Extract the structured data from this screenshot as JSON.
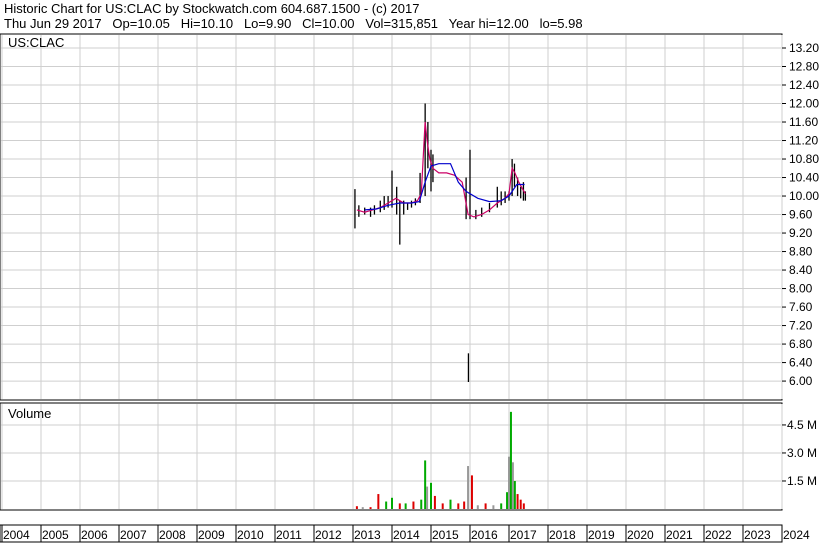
{
  "header": {
    "line1": "Historic Chart for US:CLAC by Stockwatch.com 604.687.1500 - (c) 2017",
    "line2": "Thu Jun 29 2017   Op=10.05   Hi=10.10   Lo=9.90   Cl=10.00   Vol=315,851   Year hi=12.00   lo=5.98"
  },
  "chart_data": [
    {
      "type": "line",
      "title": "US:CLAC",
      "ylim": [
        5.8,
        13.4
      ],
      "yticks": [
        "13.20",
        "12.80",
        "12.40",
        "12.00",
        "11.60",
        "11.20",
        "10.80",
        "10.40",
        "10.00",
        "9.60",
        "9.20",
        "8.80",
        "8.40",
        "8.00",
        "7.60",
        "7.20",
        "6.80",
        "6.40",
        "6.00"
      ],
      "xlim": [
        2004,
        2024
      ],
      "xticks": [
        "2004",
        "2005",
        "2006",
        "2007",
        "2008",
        "2009",
        "2010",
        "2011",
        "2012",
        "2013",
        "2014",
        "2015",
        "2016",
        "2017",
        "2018",
        "2019",
        "2020",
        "2021",
        "2022",
        "2023",
        "2024"
      ],
      "grid": true,
      "series": [
        {
          "style": "price-bars",
          "color": "#000000",
          "points": [
            {
              "x": 2013.05,
              "hi": 10.15,
              "lo": 9.3
            },
            {
              "x": 2013.15,
              "hi": 9.8,
              "lo": 9.55
            },
            {
              "x": 2013.3,
              "hi": 9.75,
              "lo": 9.6
            },
            {
              "x": 2013.45,
              "hi": 9.75,
              "lo": 9.55
            },
            {
              "x": 2013.55,
              "hi": 9.8,
              "lo": 9.6
            },
            {
              "x": 2013.7,
              "hi": 9.9,
              "lo": 9.65
            },
            {
              "x": 2013.8,
              "hi": 10.0,
              "lo": 9.7
            },
            {
              "x": 2013.9,
              "hi": 10.0,
              "lo": 9.75
            },
            {
              "x": 2014.0,
              "hi": 10.55,
              "lo": 9.75
            },
            {
              "x": 2014.12,
              "hi": 10.2,
              "lo": 9.6
            },
            {
              "x": 2014.2,
              "hi": 9.9,
              "lo": 8.95
            },
            {
              "x": 2014.3,
              "hi": 9.9,
              "lo": 9.6
            },
            {
              "x": 2014.4,
              "hi": 9.85,
              "lo": 9.7
            },
            {
              "x": 2014.5,
              "hi": 9.9,
              "lo": 9.75
            },
            {
              "x": 2014.6,
              "hi": 9.95,
              "lo": 9.8
            },
            {
              "x": 2014.72,
              "hi": 10.5,
              "lo": 9.85
            },
            {
              "x": 2014.85,
              "hi": 12.0,
              "lo": 10.0
            },
            {
              "x": 2014.92,
              "hi": 11.6,
              "lo": 10.6
            },
            {
              "x": 2015.0,
              "hi": 11.0,
              "lo": 10.1
            },
            {
              "x": 2015.05,
              "hi": 10.9,
              "lo": 10.3
            },
            {
              "x": 2015.9,
              "hi": 10.4,
              "lo": 9.5
            },
            {
              "x": 2015.96,
              "hi": 6.6,
              "lo": 5.98
            },
            {
              "x": 2016.0,
              "hi": 11.0,
              "lo": 9.5
            },
            {
              "x": 2016.15,
              "hi": 9.7,
              "lo": 9.5
            },
            {
              "x": 2016.3,
              "hi": 9.75,
              "lo": 9.55
            },
            {
              "x": 2016.5,
              "hi": 9.85,
              "lo": 9.65
            },
            {
              "x": 2016.7,
              "hi": 10.2,
              "lo": 9.75
            },
            {
              "x": 2016.8,
              "hi": 10.1,
              "lo": 9.8
            },
            {
              "x": 2016.9,
              "hi": 10.1,
              "lo": 9.85
            },
            {
              "x": 2017.0,
              "hi": 10.1,
              "lo": 9.9
            },
            {
              "x": 2017.08,
              "hi": 10.8,
              "lo": 10.0
            },
            {
              "x": 2017.14,
              "hi": 10.7,
              "lo": 10.2
            },
            {
              "x": 2017.22,
              "hi": 10.4,
              "lo": 10.0
            },
            {
              "x": 2017.3,
              "hi": 10.2,
              "lo": 9.95
            },
            {
              "x": 2017.37,
              "hi": 10.3,
              "lo": 9.9
            },
            {
              "x": 2017.42,
              "hi": 10.1,
              "lo": 9.9
            }
          ]
        },
        {
          "style": "line",
          "color": "#cc0066",
          "points": [
            [
              2013.1,
              9.7
            ],
            [
              2013.3,
              9.65
            ],
            [
              2013.5,
              9.7
            ],
            [
              2013.7,
              9.75
            ],
            [
              2013.9,
              9.85
            ],
            [
              2014.1,
              9.95
            ],
            [
              2014.3,
              9.85
            ],
            [
              2014.5,
              9.85
            ],
            [
              2014.65,
              9.9
            ],
            [
              2014.75,
              10.05
            ],
            [
              2014.85,
              11.6
            ],
            [
              2014.9,
              11.2
            ],
            [
              2014.97,
              10.8
            ],
            [
              2015.05,
              10.6
            ],
            [
              2015.2,
              10.5
            ],
            [
              2015.4,
              10.5
            ],
            [
              2015.6,
              10.45
            ],
            [
              2015.8,
              10.3
            ],
            [
              2015.95,
              9.6
            ],
            [
              2016.1,
              9.55
            ],
            [
              2016.3,
              9.6
            ],
            [
              2016.5,
              9.7
            ],
            [
              2016.7,
              9.85
            ],
            [
              2016.9,
              9.95
            ],
            [
              2017.0,
              10.05
            ],
            [
              2017.08,
              10.6
            ],
            [
              2017.15,
              10.5
            ],
            [
              2017.25,
              10.3
            ],
            [
              2017.35,
              10.15
            ],
            [
              2017.42,
              10.05
            ]
          ]
        },
        {
          "style": "line",
          "color": "#0000cc",
          "points": [
            [
              2013.3,
              9.7
            ],
            [
              2013.6,
              9.72
            ],
            [
              2013.9,
              9.8
            ],
            [
              2014.2,
              9.85
            ],
            [
              2014.5,
              9.85
            ],
            [
              2014.7,
              9.88
            ],
            [
              2014.85,
              10.3
            ],
            [
              2015.0,
              10.65
            ],
            [
              2015.2,
              10.7
            ],
            [
              2015.5,
              10.7
            ],
            [
              2015.7,
              10.3
            ],
            [
              2015.9,
              10.1
            ],
            [
              2016.2,
              9.95
            ],
            [
              2016.5,
              9.88
            ],
            [
              2016.8,
              9.9
            ],
            [
              2017.0,
              10.0
            ],
            [
              2017.2,
              10.25
            ],
            [
              2017.4,
              10.25
            ]
          ]
        }
      ]
    },
    {
      "type": "bar",
      "title": "Volume",
      "ylim": [
        0,
        6.0
      ],
      "yticks": [
        "4.5 M",
        "3.0 M",
        "1.5 M"
      ],
      "ytick_values": [
        4.5,
        3.0,
        1.5
      ],
      "xlim": [
        2004,
        2024
      ],
      "grid": true,
      "colors": {
        "up": "#00aa00",
        "down": "#dd0000",
        "flat": "#999999"
      },
      "bars": [
        {
          "x": 2013.1,
          "v": 0.15,
          "c": "down"
        },
        {
          "x": 2013.25,
          "v": 0.1,
          "c": "flat"
        },
        {
          "x": 2013.45,
          "v": 0.1,
          "c": "down"
        },
        {
          "x": 2013.65,
          "v": 0.8,
          "c": "down"
        },
        {
          "x": 2013.85,
          "v": 0.4,
          "c": "up"
        },
        {
          "x": 2014.0,
          "v": 0.6,
          "c": "up"
        },
        {
          "x": 2014.2,
          "v": 0.3,
          "c": "down"
        },
        {
          "x": 2014.35,
          "v": 0.3,
          "c": "up"
        },
        {
          "x": 2014.55,
          "v": 0.4,
          "c": "down"
        },
        {
          "x": 2014.75,
          "v": 0.5,
          "c": "up"
        },
        {
          "x": 2014.85,
          "v": 2.6,
          "c": "up"
        },
        {
          "x": 2014.9,
          "v": 1.2,
          "c": "flat"
        },
        {
          "x": 2015.0,
          "v": 1.4,
          "c": "up"
        },
        {
          "x": 2015.1,
          "v": 0.7,
          "c": "down"
        },
        {
          "x": 2015.3,
          "v": 0.3,
          "c": "down"
        },
        {
          "x": 2015.5,
          "v": 0.5,
          "c": "up"
        },
        {
          "x": 2015.7,
          "v": 0.3,
          "c": "down"
        },
        {
          "x": 2015.85,
          "v": 0.4,
          "c": "down"
        },
        {
          "x": 2015.95,
          "v": 2.3,
          "c": "flat"
        },
        {
          "x": 2016.05,
          "v": 1.8,
          "c": "down"
        },
        {
          "x": 2016.2,
          "v": 0.2,
          "c": "flat"
        },
        {
          "x": 2016.4,
          "v": 0.3,
          "c": "down"
        },
        {
          "x": 2016.6,
          "v": 0.2,
          "c": "flat"
        },
        {
          "x": 2016.8,
          "v": 0.3,
          "c": "up"
        },
        {
          "x": 2016.95,
          "v": 0.9,
          "c": "up"
        },
        {
          "x": 2017.0,
          "v": 2.8,
          "c": "flat"
        },
        {
          "x": 2017.05,
          "v": 5.2,
          "c": "up"
        },
        {
          "x": 2017.1,
          "v": 2.5,
          "c": "flat"
        },
        {
          "x": 2017.15,
          "v": 1.5,
          "c": "up"
        },
        {
          "x": 2017.22,
          "v": 0.8,
          "c": "down"
        },
        {
          "x": 2017.3,
          "v": 0.5,
          "c": "down"
        },
        {
          "x": 2017.38,
          "v": 0.3,
          "c": "down"
        }
      ]
    }
  ]
}
